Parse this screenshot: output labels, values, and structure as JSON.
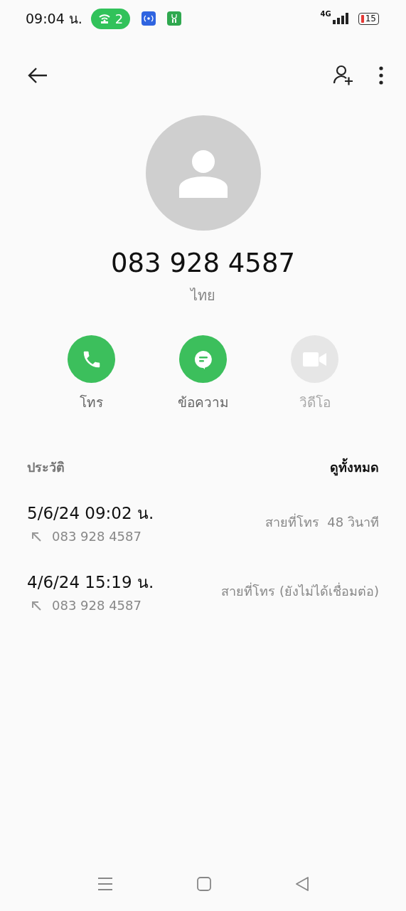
{
  "status_bar": {
    "time": "09:04 น.",
    "hotspot_count": "2",
    "network": "4G",
    "battery": "15"
  },
  "contact": {
    "number": "083 928 4587",
    "region": "ไทย"
  },
  "actions": [
    {
      "kind": "call",
      "label": "โทร",
      "disabled": false
    },
    {
      "kind": "message",
      "label": "ข้อความ",
      "disabled": false
    },
    {
      "kind": "video",
      "label": "วิดีโอ",
      "disabled": true
    }
  ],
  "history": {
    "title": "ประวัติ",
    "view_all": "ดูทั้งหมด",
    "entries": [
      {
        "datetime": "5/6/24 09:02 น.",
        "number": "083 928 4587",
        "detail": "สายที่โทร  48 วินาที"
      },
      {
        "datetime": "4/6/24 15:19 น.",
        "number": "083 928 4587",
        "detail": "สายที่โทร (ยังไม่ได้เชื่อมต่อ)"
      }
    ]
  }
}
